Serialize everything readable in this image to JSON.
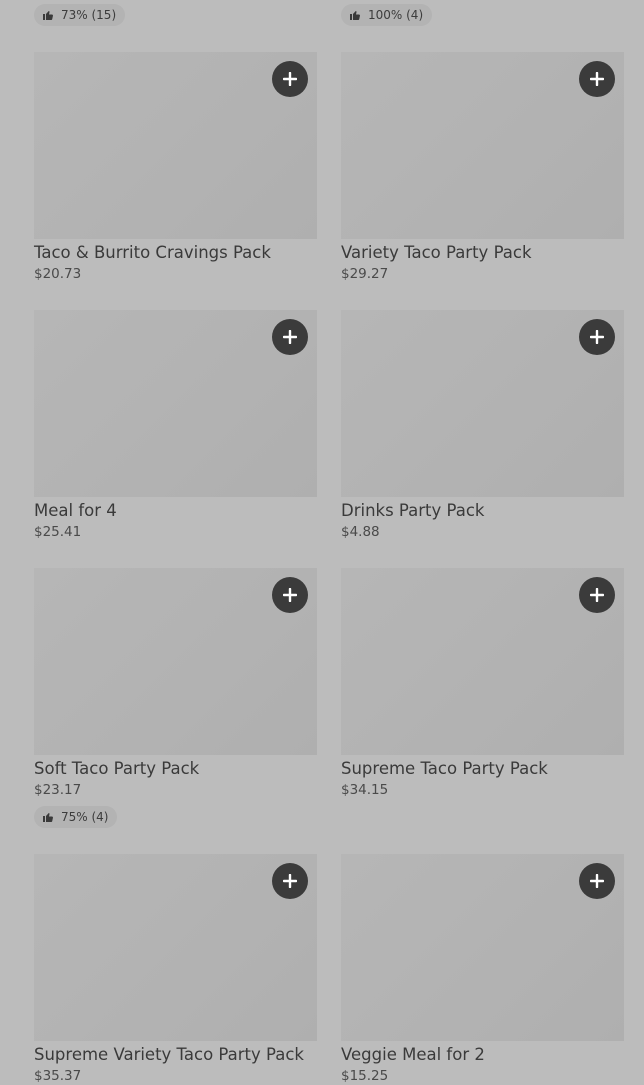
{
  "top_ratings": [
    {
      "text": "73% (15)"
    },
    {
      "text": "100% (4)"
    }
  ],
  "items": [
    {
      "name": "Taco & Burrito Cravings Pack",
      "price": "$20.73"
    },
    {
      "name": "Variety Taco Party Pack",
      "price": "$29.27"
    },
    {
      "name": "Meal for 4",
      "price": "$25.41"
    },
    {
      "name": "Drinks Party Pack",
      "price": "$4.88"
    },
    {
      "name": "Soft Taco Party Pack",
      "price": "$23.17",
      "rating": "75% (4)"
    },
    {
      "name": "Supreme Taco Party Pack",
      "price": "$34.15"
    },
    {
      "name": "Supreme Variety Taco Party Pack",
      "price": "$35.37"
    },
    {
      "name": "Veggie Meal for 2",
      "price": "$15.25"
    }
  ],
  "icons": {
    "add": "plus-icon",
    "rating": "thumbs-up-icon"
  },
  "colors": {
    "background": "#bcbcbc",
    "image_placeholder": "#b3b3b3",
    "add_button": "#3b3b3b",
    "text": "#3a3a3a"
  }
}
